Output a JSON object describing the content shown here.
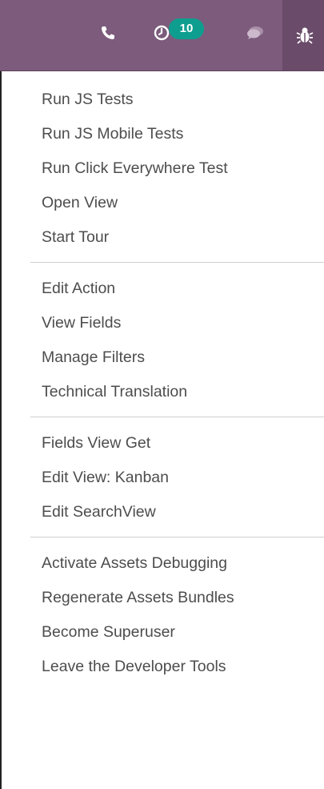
{
  "topbar": {
    "background": "#7c5b7c",
    "icons": {
      "phone": "phone-icon",
      "activity": "clock-icon",
      "chat": "chat-icon",
      "debug": "bug-icon"
    },
    "activity_badge": {
      "count": "10",
      "color": "#0e9e8f"
    }
  },
  "debug_menu": {
    "groups": [
      {
        "items": [
          "Run JS Tests",
          "Run JS Mobile Tests",
          "Run Click Everywhere Test",
          "Open View",
          "Start Tour"
        ]
      },
      {
        "items": [
          "Edit Action",
          "View Fields",
          "Manage Filters",
          "Technical Translation"
        ]
      },
      {
        "items": [
          "Fields View Get",
          "Edit View: Kanban",
          "Edit SearchView"
        ]
      },
      {
        "items": [
          "Activate Assets Debugging",
          "Regenerate Assets Bundles",
          "Become Superuser",
          "Leave the Developer Tools"
        ]
      }
    ]
  }
}
